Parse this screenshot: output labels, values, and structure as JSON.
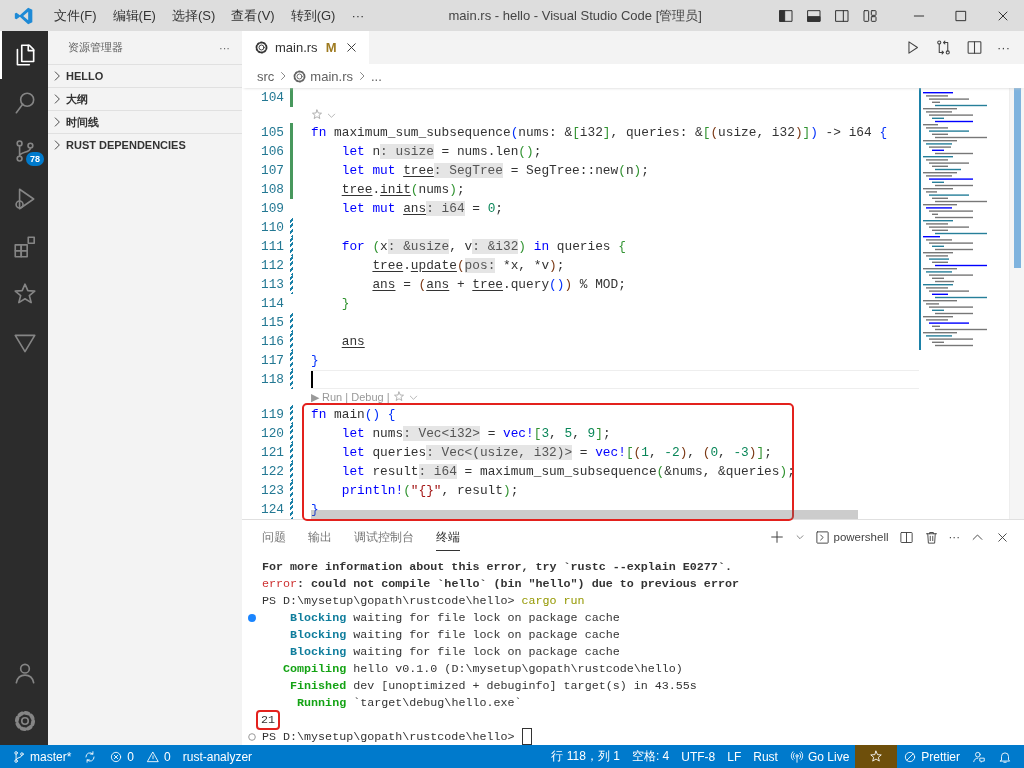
{
  "title_bar": {
    "menus": [
      "文件(F)",
      "编辑(E)",
      "选择(S)",
      "查看(V)",
      "转到(G)"
    ],
    "more": "···",
    "title": "main.rs - hello - Visual Studio Code [管理员]"
  },
  "activity_bar": {
    "items": [
      {
        "kind": "files",
        "selected": true
      },
      {
        "kind": "search",
        "selected": false
      },
      {
        "kind": "branch",
        "selected": false,
        "badge": "78"
      },
      {
        "kind": "debug",
        "selected": false
      },
      {
        "kind": "extensions",
        "selected": false
      },
      {
        "kind": "star",
        "selected": false
      },
      {
        "kind": "triangle",
        "selected": false
      }
    ],
    "bottom": [
      {
        "kind": "account"
      },
      {
        "kind": "gear"
      }
    ]
  },
  "sidebar": {
    "title": "资源管理器",
    "more": "···",
    "sections": [
      {
        "label": "HELLO",
        "expanded": false
      },
      {
        "label": "大纲",
        "expanded": false
      },
      {
        "label": "时间线",
        "expanded": false
      },
      {
        "label": "RUST DEPENDENCIES",
        "expanded": false
      }
    ]
  },
  "tabs": [
    {
      "label": "main.rs",
      "status": "M",
      "selected": true
    }
  ],
  "editor_actions_more": "···",
  "breadcrumbs": [
    "src",
    "main.rs",
    "..."
  ],
  "editor": {
    "lines": [
      {
        "kind": "line",
        "number": "104",
        "added": true,
        "modified": false,
        "boxed": false
      },
      {
        "kind": "codelens",
        "boxed": false
      },
      {
        "kind": "line",
        "number": "105",
        "added": true,
        "modified": false,
        "boxed": false,
        "tokens": [
          {
            "kind": "kw",
            "text": "fn"
          },
          {
            "kind": "plain",
            "text": " maximum_sum_subsequence"
          },
          {
            "kind": "b1",
            "text": "("
          },
          {
            "kind": "plain",
            "text": "nums: &"
          },
          {
            "kind": "b2",
            "text": "["
          },
          {
            "kind": "plain",
            "text": "i32"
          },
          {
            "kind": "b2",
            "text": "]"
          },
          {
            "kind": "plain",
            "text": ", queries: &"
          },
          {
            "kind": "b2",
            "text": "["
          },
          {
            "kind": "b3",
            "text": "("
          },
          {
            "kind": "plain",
            "text": "usize, i32"
          },
          {
            "kind": "b3",
            "text": ")"
          },
          {
            "kind": "b2",
            "text": "]"
          },
          {
            "kind": "b1",
            "text": ")"
          },
          {
            "kind": "plain",
            "text": " -> i64 "
          },
          {
            "kind": "b1",
            "text": "{"
          }
        ],
        "children": [
          {
            "kind": "line",
            "number": "106",
            "added": true,
            "modified": false,
            "boxed": false,
            "tokens": [
              {
                "kind": "kw",
                "text": "let"
              },
              {
                "kind": "plain",
                "text": " n"
              },
              {
                "kind": "hint",
                "text": ": usize"
              },
              {
                "kind": "plain",
                "text": " = nums.len"
              },
              {
                "kind": "b2",
                "text": "()"
              },
              {
                "kind": "plain",
                "text": ";"
              }
            ]
          },
          {
            "kind": "line",
            "number": "107",
            "added": true,
            "modified": false,
            "boxed": false,
            "tokens": [
              {
                "kind": "kw",
                "text": "let mut "
              },
              {
                "kind": "mut",
                "text": "tree"
              },
              {
                "kind": "hint",
                "text": ": SegTree"
              },
              {
                "kind": "plain",
                "text": " = SegTree::new"
              },
              {
                "kind": "b2",
                "text": "("
              },
              {
                "kind": "plain",
                "text": "n"
              },
              {
                "kind": "b2",
                "text": ")"
              },
              {
                "kind": "plain",
                "text": ";"
              }
            ]
          },
          {
            "kind": "line",
            "number": "108",
            "added": true,
            "modified": false,
            "boxed": false,
            "tokens": [
              {
                "kind": "mut",
                "text": "tree"
              },
              {
                "kind": "plain",
                "text": "."
              },
              {
                "kind": "mut",
                "text": "init"
              },
              {
                "kind": "b2",
                "text": "("
              },
              {
                "kind": "plain",
                "text": "nums"
              },
              {
                "kind": "b2",
                "text": ")"
              },
              {
                "kind": "plain",
                "text": ";"
              }
            ]
          },
          {
            "kind": "line",
            "number": "109",
            "added": false,
            "modified": false,
            "boxed": false,
            "tokens": [
              {
                "kind": "kw",
                "text": "let mut "
              },
              {
                "kind": "mut",
                "text": "ans"
              },
              {
                "kind": "hint",
                "text": ": i64"
              },
              {
                "kind": "plain",
                "text": " = "
              },
              {
                "kind": "num",
                "text": "0"
              },
              {
                "kind": "plain",
                "text": ";"
              }
            ]
          },
          {
            "kind": "line",
            "number": "110",
            "added": false,
            "modified": true,
            "boxed": false
          },
          {
            "kind": "line",
            "number": "111",
            "added": false,
            "modified": true,
            "boxed": false,
            "tokens": [
              {
                "kind": "kw",
                "text": "for "
              },
              {
                "kind": "b2",
                "text": "("
              },
              {
                "kind": "plain",
                "text": "x"
              },
              {
                "kind": "hint",
                "text": ": &usize"
              },
              {
                "kind": "plain",
                "text": ", v"
              },
              {
                "kind": "hint",
                "text": ": &i32"
              },
              {
                "kind": "b2",
                "text": ")"
              },
              {
                "kind": "kw",
                "text": " in"
              },
              {
                "kind": "plain",
                "text": " queries "
              },
              {
                "kind": "b2",
                "text": "{"
              }
            ],
            "children": [
              {
                "kind": "line",
                "number": "112",
                "added": false,
                "modified": true,
                "boxed": false,
                "tokens": [
                  {
                    "kind": "mut",
                    "text": "tree"
                  },
                  {
                    "kind": "plain",
                    "text": "."
                  },
                  {
                    "kind": "mut",
                    "text": "update"
                  },
                  {
                    "kind": "b3",
                    "text": "("
                  },
                  {
                    "kind": "hint",
                    "text": "pos:"
                  },
                  {
                    "kind": "plain",
                    "text": " *x, *v"
                  },
                  {
                    "kind": "b3",
                    "text": ")"
                  },
                  {
                    "kind": "plain",
                    "text": ";"
                  }
                ]
              },
              {
                "kind": "line",
                "number": "113",
                "added": false,
                "modified": true,
                "boxed": false,
                "tokens": [
                  {
                    "kind": "mut",
                    "text": "ans"
                  },
                  {
                    "kind": "plain",
                    "text": " = "
                  },
                  {
                    "kind": "b3",
                    "text": "("
                  },
                  {
                    "kind": "mut",
                    "text": "ans"
                  },
                  {
                    "kind": "plain",
                    "text": " + "
                  },
                  {
                    "kind": "mut",
                    "text": "tree"
                  },
                  {
                    "kind": "plain",
                    "text": ".query"
                  },
                  {
                    "kind": "b1",
                    "text": "()"
                  },
                  {
                    "kind": "b3",
                    "text": ")"
                  },
                  {
                    "kind": "plain",
                    "text": " % MOD;"
                  }
                ]
              }
            ]
          },
          {
            "kind": "line",
            "number": "114",
            "added": false,
            "modified": false,
            "boxed": false,
            "tokens": [
              {
                "kind": "b2",
                "text": "}"
              }
            ]
          },
          {
            "kind": "line",
            "number": "115",
            "added": false,
            "modified": true,
            "boxed": false
          },
          {
            "kind": "line",
            "number": "116",
            "added": false,
            "modified": true,
            "boxed": false,
            "tokens": [
              {
                "kind": "mut",
                "text": "ans"
              }
            ]
          }
        ]
      },
      {
        "kind": "line",
        "number": "117",
        "added": false,
        "modified": true,
        "boxed": false,
        "tokens": [
          {
            "kind": "b1",
            "text": "}"
          }
        ]
      },
      {
        "kind": "line",
        "number": "118",
        "added": false,
        "modified": true,
        "boxed": false,
        "cursor": true
      },
      {
        "kind": "codelens",
        "text": "▶ Run | Debug |",
        "boxed": false
      },
      {
        "kind": "line",
        "number": "119",
        "added": false,
        "modified": true,
        "boxed": true,
        "tokens": [
          {
            "kind": "kw",
            "text": "fn"
          },
          {
            "kind": "plain",
            "text": " main"
          },
          {
            "kind": "b1",
            "text": "() {"
          }
        ],
        "children": [
          {
            "kind": "line",
            "number": "120",
            "added": false,
            "modified": true,
            "boxed": true,
            "tokens": [
              {
                "kind": "kw",
                "text": "let"
              },
              {
                "kind": "plain",
                "text": " nums"
              },
              {
                "kind": "hint",
                "text": ": Vec<i32>"
              },
              {
                "kind": "plain",
                "text": " = "
              },
              {
                "kind": "kw",
                "text": "vec!"
              },
              {
                "kind": "b2",
                "text": "["
              },
              {
                "kind": "num",
                "text": "3"
              },
              {
                "kind": "plain",
                "text": ", "
              },
              {
                "kind": "num",
                "text": "5"
              },
              {
                "kind": "plain",
                "text": ", "
              },
              {
                "kind": "num",
                "text": "9"
              },
              {
                "kind": "b2",
                "text": "]"
              },
              {
                "kind": "plain",
                "text": ";"
              }
            ]
          },
          {
            "kind": "line",
            "number": "121",
            "added": false,
            "modified": true,
            "boxed": true,
            "tokens": [
              {
                "kind": "kw",
                "text": "let"
              },
              {
                "kind": "plain",
                "text": " queries"
              },
              {
                "kind": "hint",
                "text": ": Vec<(usize, i32)>"
              },
              {
                "kind": "plain",
                "text": " = "
              },
              {
                "kind": "kw",
                "text": "vec!"
              },
              {
                "kind": "b2",
                "text": "["
              },
              {
                "kind": "b3",
                "text": "("
              },
              {
                "kind": "num",
                "text": "1"
              },
              {
                "kind": "plain",
                "text": ", "
              },
              {
                "kind": "num",
                "text": "-2"
              },
              {
                "kind": "b3",
                "text": ")"
              },
              {
                "kind": "plain",
                "text": ", "
              },
              {
                "kind": "b3",
                "text": "("
              },
              {
                "kind": "num",
                "text": "0"
              },
              {
                "kind": "plain",
                "text": ", "
              },
              {
                "kind": "num",
                "text": "-3"
              },
              {
                "kind": "b3",
                "text": ")"
              },
              {
                "kind": "b2",
                "text": "]"
              },
              {
                "kind": "plain",
                "text": ";"
              }
            ]
          },
          {
            "kind": "line",
            "number": "122",
            "added": false,
            "modified": true,
            "boxed": true,
            "tokens": [
              {
                "kind": "kw",
                "text": "let"
              },
              {
                "kind": "plain",
                "text": " result"
              },
              {
                "kind": "hint",
                "text": ": i64"
              },
              {
                "kind": "plain",
                "text": " = maximum_sum_subsequence"
              },
              {
                "kind": "b2",
                "text": "("
              },
              {
                "kind": "plain",
                "text": "&nums, &queries"
              },
              {
                "kind": "b2",
                "text": ")"
              },
              {
                "kind": "plain",
                "text": ";"
              }
            ]
          },
          {
            "kind": "line",
            "number": "123",
            "added": false,
            "modified": true,
            "boxed": true,
            "tokens": [
              {
                "kind": "kw",
                "text": "println!"
              },
              {
                "kind": "b2",
                "text": "("
              },
              {
                "kind": "str",
                "text": "\"{}\""
              },
              {
                "kind": "plain",
                "text": ", result"
              },
              {
                "kind": "b2",
                "text": ")"
              },
              {
                "kind": "plain",
                "text": ";"
              }
            ]
          }
        ]
      },
      {
        "kind": "line",
        "number": "124",
        "added": false,
        "modified": true,
        "boxed": true,
        "tokens": [
          {
            "kind": "b1",
            "text": "}"
          }
        ]
      }
    ]
  },
  "panel": {
    "tabs": [
      {
        "label": "问题",
        "selected": false
      },
      {
        "label": "输出",
        "selected": false
      },
      {
        "label": "调试控制台",
        "selected": false
      },
      {
        "label": "终端",
        "selected": true
      }
    ],
    "terminal_name": "powershell",
    "more": "···",
    "terminal": [
      {
        "filled_mark": false,
        "hollow_mark": false,
        "boxed": false,
        "cursor": false,
        "tokens": [
          {
            "kind": "bold",
            "text": "For more information about this error, try `rustc --explain E0277`."
          }
        ]
      },
      {
        "filled_mark": false,
        "hollow_mark": false,
        "boxed": false,
        "cursor": false,
        "tokens": [
          {
            "kind": "err",
            "text": "error"
          },
          {
            "kind": "bold",
            "text": ": could not compile `hello` (bin \"hello\") due to previous error"
          }
        ]
      },
      {
        "filled_mark": false,
        "hollow_mark": false,
        "boxed": false,
        "cursor": false,
        "tokens": [
          {
            "kind": "plain",
            "text": "PS D:\\mysetup\\gopath\\rustcode\\hello> "
          },
          {
            "kind": "cmd",
            "text": "cargo run"
          }
        ]
      },
      {
        "filled_mark": true,
        "hollow_mark": false,
        "boxed": false,
        "cursor": false,
        "tokens": [
          {
            "kind": "info",
            "text": "    Blocking"
          },
          {
            "kind": "plain",
            "text": " waiting for file lock on package cache"
          }
        ]
      },
      {
        "filled_mark": false,
        "hollow_mark": false,
        "boxed": false,
        "cursor": false,
        "tokens": [
          {
            "kind": "info",
            "text": "    Blocking"
          },
          {
            "kind": "plain",
            "text": " waiting for file lock on package cache"
          }
        ]
      },
      {
        "filled_mark": false,
        "hollow_mark": false,
        "boxed": false,
        "cursor": false,
        "tokens": [
          {
            "kind": "info",
            "text": "    Blocking"
          },
          {
            "kind": "plain",
            "text": " waiting for file lock on package cache"
          }
        ]
      },
      {
        "filled_mark": false,
        "hollow_mark": false,
        "boxed": false,
        "cursor": false,
        "tokens": [
          {
            "kind": "ok",
            "text": "   Compiling"
          },
          {
            "kind": "plain",
            "text": " hello v0.1.0 (D:\\mysetup\\gopath\\rustcode\\hello)"
          }
        ]
      },
      {
        "filled_mark": false,
        "hollow_mark": false,
        "boxed": false,
        "cursor": false,
        "tokens": [
          {
            "kind": "ok",
            "text": "    Finished"
          },
          {
            "kind": "plain",
            "text": " dev [unoptimized + debuginfo] target(s) in 43.55s"
          }
        ]
      },
      {
        "filled_mark": false,
        "hollow_mark": false,
        "boxed": false,
        "cursor": false,
        "tokens": [
          {
            "kind": "ok",
            "text": "     Running"
          },
          {
            "kind": "plain",
            "text": " `target\\debug\\hello.exe`"
          }
        ]
      },
      {
        "filled_mark": false,
        "hollow_mark": false,
        "boxed": true,
        "cursor": false,
        "tokens": [
          {
            "kind": "plain",
            "text": "21"
          }
        ]
      },
      {
        "filled_mark": false,
        "hollow_mark": true,
        "boxed": false,
        "cursor": true,
        "tokens": [
          {
            "kind": "plain",
            "text": "PS D:\\mysetup\\gopath\\rustcode\\hello> "
          }
        ]
      }
    ]
  },
  "status_bar": {
    "left": [
      {
        "kind": "branch",
        "text": "master*"
      },
      {
        "kind": "sync"
      },
      {
        "kind": "error",
        "text": "0"
      },
      {
        "kind": "warning",
        "text": "0"
      },
      {
        "text": "rust-analyzer"
      }
    ],
    "right": [
      {
        "text": "行 118，列 1"
      },
      {
        "text": "空格: 4"
      },
      {
        "text": "UTF-8"
      },
      {
        "text": "LF"
      },
      {
        "text": "Rust"
      },
      {
        "kind": "broadcast",
        "text": "Go Live"
      },
      {
        "kind": "star",
        "highlighted": true
      },
      {
        "kind": "blocked",
        "text": "Prettier"
      },
      {
        "kind": "feedback"
      },
      {
        "kind": "bell"
      }
    ]
  }
}
